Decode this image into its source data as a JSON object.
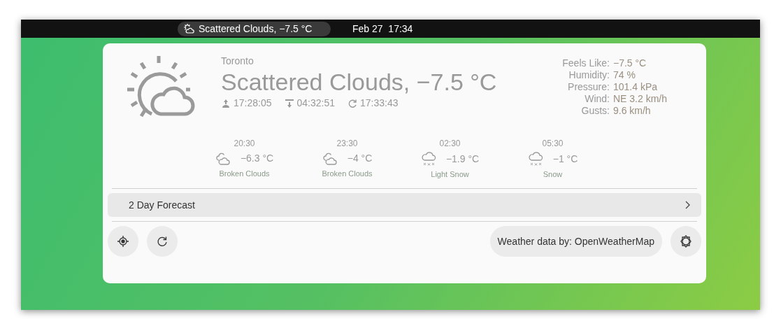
{
  "top_bar": {
    "indicator": "Scattered Clouds, −7.5 °C",
    "clock": "Feb 27  17:34"
  },
  "current": {
    "city": "Toronto",
    "summary": "Scattered Clouds, −7.5 °C",
    "sunrise": "17:28:05",
    "sunset": "04:32:51",
    "updated": "17:33:43"
  },
  "details": [
    {
      "label": "Feels Like:",
      "value": "−7.5 °C"
    },
    {
      "label": "Humidity:",
      "value": "74 %"
    },
    {
      "label": "Pressure:",
      "value": "101.4 kPa"
    },
    {
      "label": "Wind:",
      "value": "NE 3.2 km/h"
    },
    {
      "label": "Gusts:",
      "value": "9.6 km/h"
    }
  ],
  "forecast": [
    {
      "time": "20:30",
      "kind": "clouds",
      "temp": "−6.3 °C",
      "condition": "Broken Clouds"
    },
    {
      "time": "23:30",
      "kind": "clouds",
      "temp": "−4 °C",
      "condition": "Broken Clouds"
    },
    {
      "time": "02:30",
      "kind": "snow",
      "temp": "−1.9 °C",
      "condition": "Light Snow"
    },
    {
      "time": "05:30",
      "kind": "snow",
      "temp": "−1 °C",
      "condition": "Snow"
    }
  ],
  "expander": {
    "label": "2 Day Forecast"
  },
  "provider_button": "Weather data by: OpenWeatherMap"
}
